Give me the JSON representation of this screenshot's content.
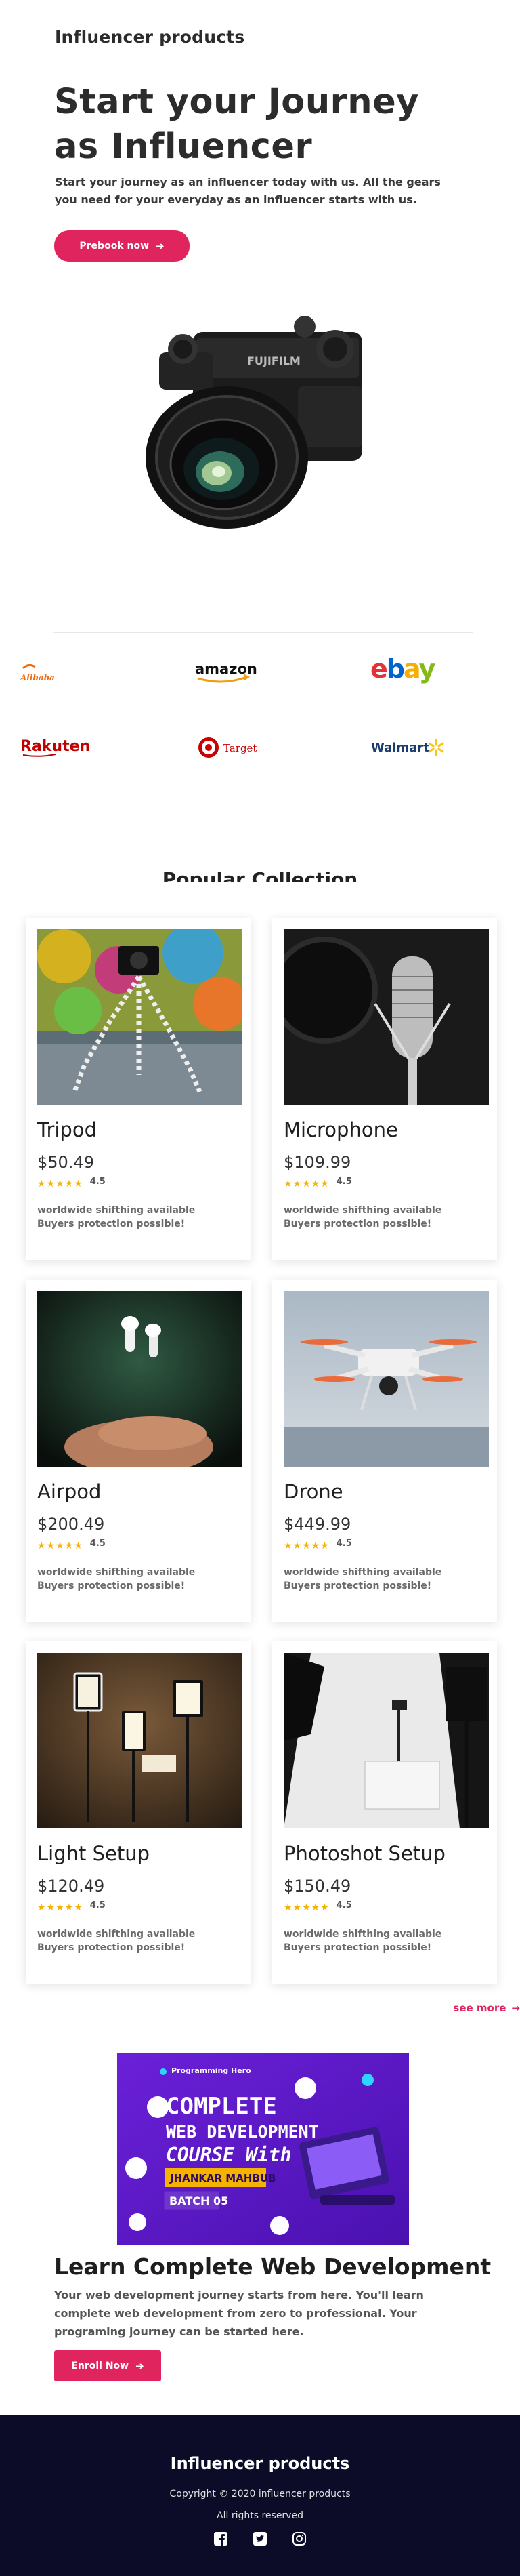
{
  "header": {
    "brand": "Influencer products"
  },
  "hero": {
    "title": "Start your Journey as Influencer",
    "description": "Start your journey as an influencer today with us. All the gears you need for your everyday as an influencer starts with us.",
    "cta_label": "Prebook now"
  },
  "partners": [
    "Alibaba",
    "amazon",
    "ebay",
    "Rakuten",
    "Target",
    "Walmart"
  ],
  "collection": {
    "title": "Popular Collection",
    "see_more": "see more",
    "products": [
      {
        "name": "Tripod",
        "price": "$50.49",
        "rating": "4.5",
        "features": "worldwide shifthing available Buyers protection possible!"
      },
      {
        "name": "Microphone",
        "price": "$109.99",
        "rating": "4.5",
        "features": "worldwide shifthing available Buyers protection possible!"
      },
      {
        "name": "Airpod",
        "price": "$200.49",
        "rating": "4.5",
        "features": "worldwide shifthing available Buyers protection possible!"
      },
      {
        "name": "Drone",
        "price": "$449.99",
        "rating": "4.5",
        "features": "worldwide shifthing available Buyers protection possible!"
      },
      {
        "name": "Light Setup",
        "price": "$120.49",
        "rating": "4.5",
        "features": "worldwide shifthing available Buyers protection possible!"
      },
      {
        "name": "Photoshot Setup",
        "price": "$150.49",
        "rating": "4.5",
        "features": "worldwide shifthing available Buyers protection possible!"
      }
    ]
  },
  "course": {
    "banner": {
      "brand": "Programming Hero",
      "line1": "COMPLETE",
      "line2": "WEB DEVELOPMENT",
      "line3": "COURSE With",
      "instructor": "JHANKAR MAHBUB",
      "batch": "BATCH 05"
    },
    "title": "Learn Complete Web Development",
    "description": "Your web development journey starts from here. You'll learn complete web development from zero to professional. Your programing journey can be started here.",
    "cta_label": "Enroll Now"
  },
  "footer": {
    "brand": "Influencer products",
    "copyright": "Copyright © 2020 influencer products",
    "rights": "All rights reserved"
  },
  "colors": {
    "accent": "#e0245e",
    "footer_bg": "#0c0c28",
    "star": "#f5b301"
  },
  "icons": [
    "arrow-right-icon",
    "star-icon",
    "facebook-icon",
    "twitter-icon",
    "instagram-icon"
  ]
}
